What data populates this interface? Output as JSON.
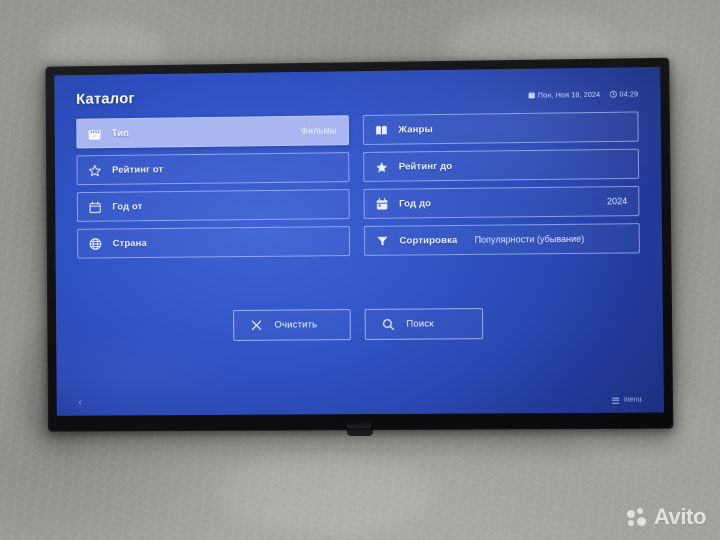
{
  "screen": {
    "title": "Каталог",
    "status": {
      "calendar_icon": "calendar-icon",
      "date": "Пон, Ноя 18, 2024",
      "clock_icon": "clock-icon",
      "time": "04:29"
    },
    "filters": [
      {
        "id": "type",
        "icon": "clapperboard-icon",
        "label": "Тип",
        "value": "Фильмы",
        "focused": true,
        "column": "left"
      },
      {
        "id": "genres",
        "icon": "book-icon",
        "label": "Жанры",
        "value": "",
        "focused": false,
        "column": "right"
      },
      {
        "id": "rating-from",
        "icon": "star-outline-icon",
        "label": "Рейтинг от",
        "value": "",
        "focused": false,
        "column": "left"
      },
      {
        "id": "rating-to",
        "icon": "star-filled-icon",
        "label": "Рейтинг до",
        "value": "",
        "focused": false,
        "column": "right"
      },
      {
        "id": "year-from",
        "icon": "calendar-outline-icon",
        "label": "Год от",
        "value": "",
        "focused": false,
        "column": "left"
      },
      {
        "id": "year-to",
        "icon": "calendar-filled-icon",
        "label": "Год до",
        "value": "2024",
        "focused": false,
        "column": "right"
      },
      {
        "id": "country",
        "icon": "globe-icon",
        "label": "Страна",
        "value": "",
        "focused": false,
        "column": "left"
      },
      {
        "id": "sort",
        "icon": "filter-icon",
        "label": "Сортировка",
        "value": "Популярности (убывание)",
        "focused": false,
        "column": "right",
        "inline": true
      }
    ],
    "actions": [
      {
        "id": "clear",
        "icon": "close-x-icon",
        "label": "Очистить"
      },
      {
        "id": "search",
        "icon": "magnifier-icon",
        "label": "Поиск"
      }
    ],
    "footer": {
      "back_glyph": "‹",
      "menu_icon": "menu-bars-icon",
      "menu_label": "menu"
    }
  },
  "watermark": {
    "text": "Avito"
  },
  "colors": {
    "screen_blue_center": "#3f63d6",
    "screen_blue_edge": "#1c3183",
    "focus_fill": "#a9b6ef",
    "row_border": "rgba(190,206,250,.62)",
    "text_primary": "#eef2ff",
    "text_secondary": "#cdd8f4",
    "bezel": "#121214",
    "wall": "#93938e"
  }
}
